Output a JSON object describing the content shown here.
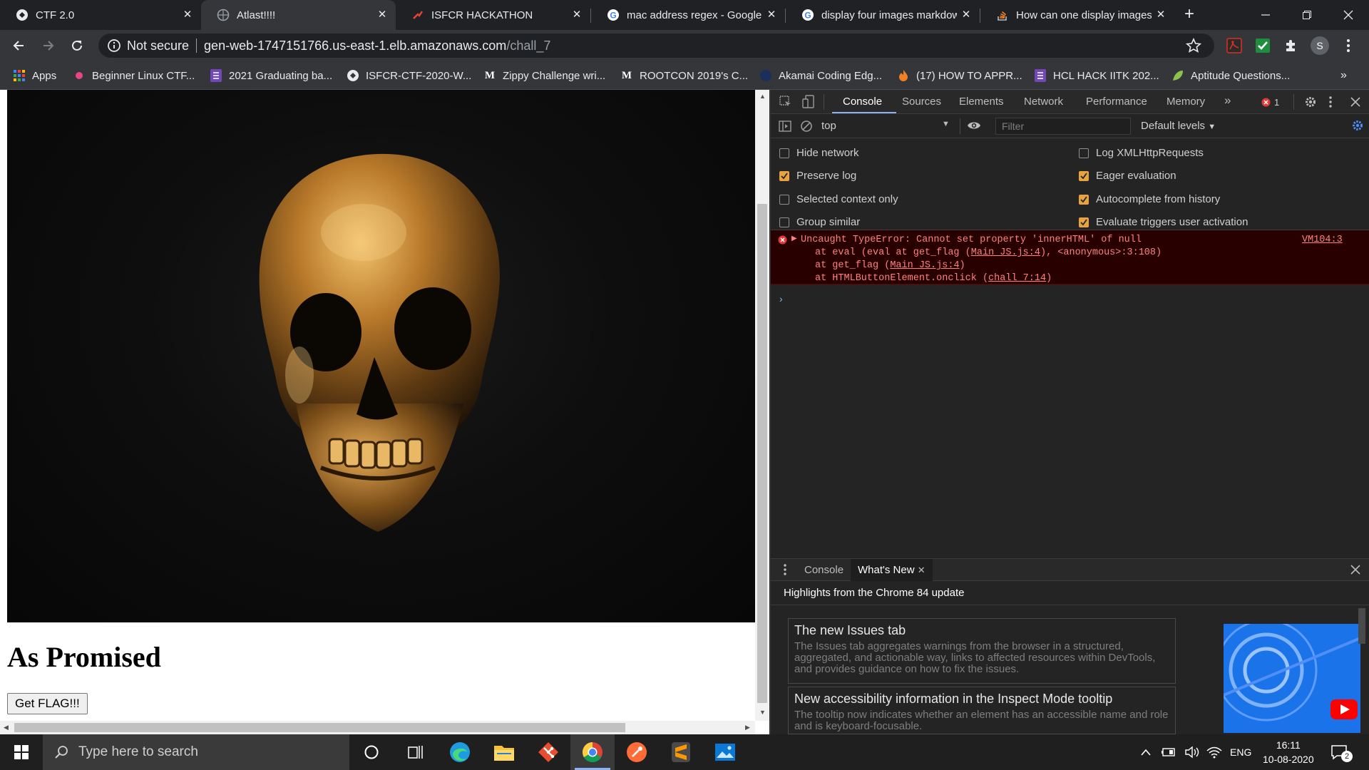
{
  "browser": {
    "tabs": [
      {
        "title": "CTF 2.0",
        "icon": "ctf-icon"
      },
      {
        "title": "Atlast!!!!",
        "icon": "globe-icon",
        "active": true
      },
      {
        "title": "ISFCR HACKATHON",
        "icon": "hackathon-icon"
      },
      {
        "title": "mac address regex - Google",
        "icon": "google-icon"
      },
      {
        "title": "display four images markdow",
        "icon": "google-icon"
      },
      {
        "title": "How can one display images",
        "icon": "stackoverflow-icon"
      }
    ],
    "security_label": "Not secure",
    "url_host": "gen-web-1747151766.us-east-1.elb.amazonaws.com",
    "url_path": "/chall_7",
    "profile_initial": "S",
    "bookmarks": [
      {
        "label": "Apps",
        "icon": "apps-grid-icon"
      },
      {
        "label": "Beginner Linux CTF...",
        "icon": "pink-dot-icon"
      },
      {
        "label": "2021 Graduating ba...",
        "icon": "form-icon"
      },
      {
        "label": "ISFCR-CTF-2020-W...",
        "icon": "ctf-icon"
      },
      {
        "label": "Zippy Challenge wri...",
        "icon": "medium-icon"
      },
      {
        "label": "ROOTCON 2019's C...",
        "icon": "medium-icon"
      },
      {
        "label": "Akamai Coding Edg...",
        "icon": "akamai-icon"
      },
      {
        "label": "(17) HOW TO APPR...",
        "icon": "flame-icon"
      },
      {
        "label": "HCL HACK IITK 202...",
        "icon": "form-icon"
      },
      {
        "label": "Aptitude Questions...",
        "icon": "leaf-icon"
      }
    ]
  },
  "page": {
    "heading": "As Promised",
    "button_label": "Get FLAG!!!"
  },
  "devtools": {
    "tabs": [
      "Console",
      "Sources",
      "Elements",
      "Network",
      "Performance",
      "Memory"
    ],
    "more": "»",
    "error_count": "1",
    "context": "top",
    "filter_placeholder": "Filter",
    "levels": "Default levels",
    "settings": {
      "hide_network": "Hide network",
      "preserve_log": "Preserve log",
      "selected_context": "Selected context only",
      "group_similar": "Group similar",
      "log_xhr": "Log XMLHttpRequests",
      "eager_eval": "Eager evaluation",
      "autocomplete": "Autocomplete from history",
      "eval_triggers": "Evaluate triggers user activation"
    },
    "error": {
      "message": "Uncaught TypeError: Cannot set property 'innerHTML' of null",
      "source": "VM104:3",
      "stack": [
        {
          "pre": "at eval (eval at get_flag (",
          "link": "Main_JS.js:4",
          "post": "), <anonymous>:3:108)"
        },
        {
          "pre": "at get_flag (",
          "link": "Main_JS.js:4",
          "post": ")"
        },
        {
          "pre": "at HTMLButtonElement.onclick (",
          "link": "chall_7:14",
          "post": ")"
        }
      ]
    },
    "drawer": {
      "tab_console": "Console",
      "tab_whatsnew": "What's New",
      "highlights": "Highlights from the Chrome 84 update",
      "cards": [
        {
          "title": "The new Issues tab",
          "body": "The Issues tab aggregates warnings from the browser in a structured, aggregated, and actionable way, links to affected resources within DevTools, and provides guidance on how to fix the issues."
        },
        {
          "title": "New accessibility information in the Inspect Mode tooltip",
          "body": "The tooltip now indicates whether an element has an accessible name and role and is keyboard-focusable."
        }
      ]
    }
  },
  "taskbar": {
    "search_placeholder": "Type here to search",
    "lang": "ENG",
    "time": "16:11",
    "date": "10-08-2020",
    "notifications": "2"
  }
}
